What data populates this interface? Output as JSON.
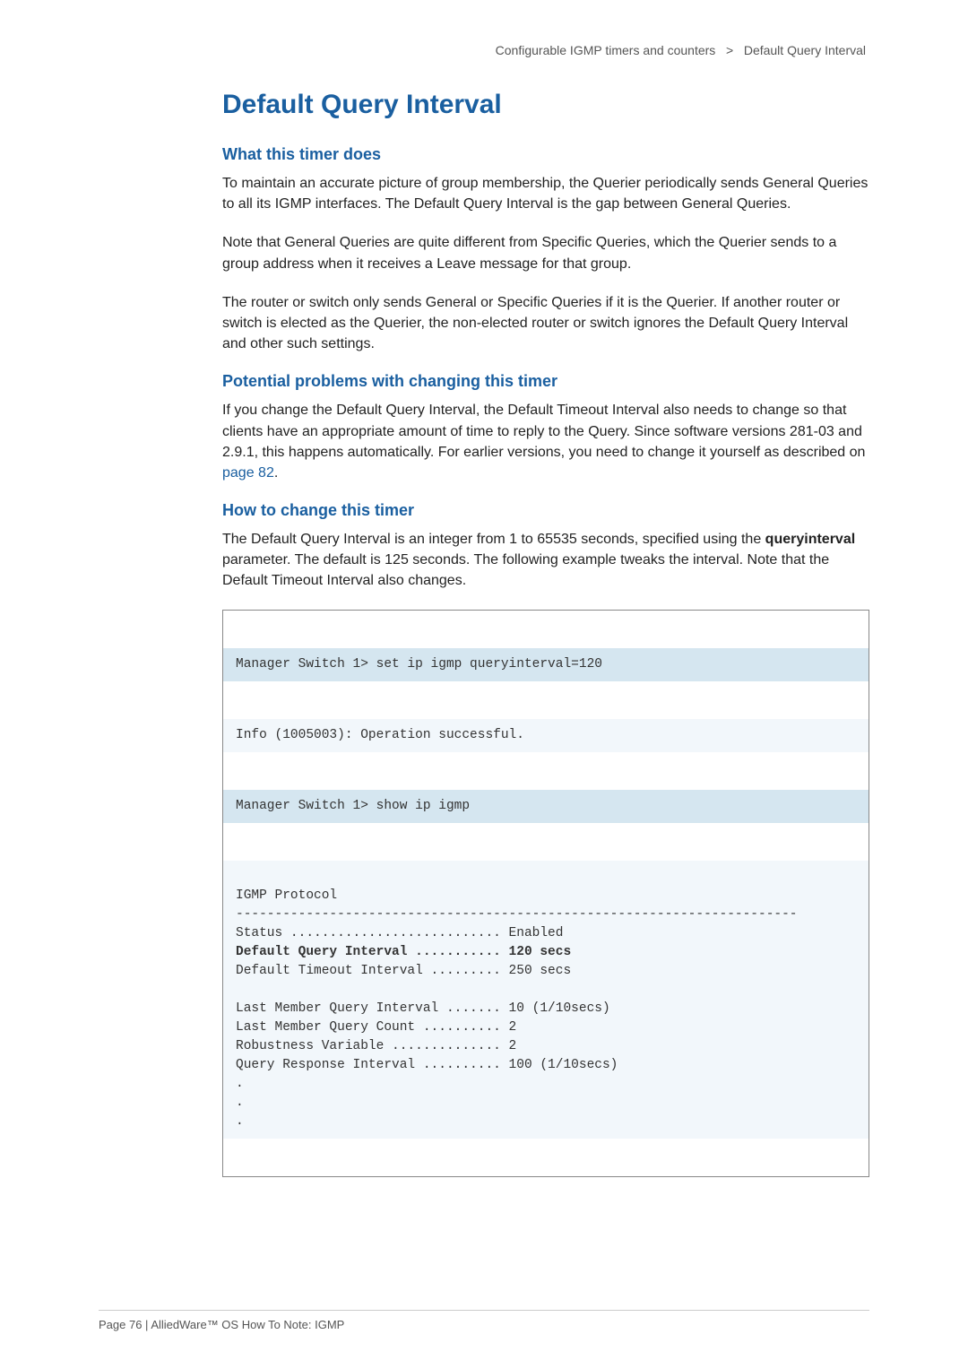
{
  "breadcrumb": {
    "left": "Configurable IGMP timers and counters",
    "sep": ">",
    "right": "Default Query Interval"
  },
  "title": "Default Query Interval",
  "sections": {
    "what": {
      "heading": "What this timer does",
      "p1": "To maintain an accurate picture of group membership, the Querier periodically sends General Queries to all its IGMP interfaces. The Default Query Interval is the gap between General Queries.",
      "p2": "Note that General Queries are quite different from Specific Queries, which the Querier sends to a group address when it receives a Leave message for that group.",
      "p3": "The router or switch only sends General or Specific Queries if it is the Querier. If another router or switch is elected as the Querier, the non-elected router or switch ignores the Default Query Interval and other such settings."
    },
    "problems": {
      "heading": "Potential problems with changing this timer",
      "p1_a": "If you change the Default Query Interval, the Default Timeout Interval also needs to change so that clients have an appropriate amount of time to reply to the Query. Since software versions 281-03 and 2.9.1, this happens automatically. For earlier versions, you need to change it yourself as described on ",
      "p1_link": "page 82",
      "p1_b": "."
    },
    "how": {
      "heading": "How to change this timer",
      "p1_a": "The Default Query Interval is an integer from 1 to 65535 seconds, specified using the ",
      "p1_bold": "queryinterval",
      "p1_b": " parameter. The default is 125 seconds. The following example tweaks the interval. Note that the Default Timeout Interval also changes."
    }
  },
  "terminal": {
    "cmd1": "Manager Switch 1> set ip igmp queryinterval=120",
    "out1": "Info (1005003): Operation successful.",
    "cmd2": "Manager Switch 1> show ip igmp",
    "out2_header": "IGMP Protocol",
    "out2_rule": "------------------------------------------------------------------------",
    "out2_status": "Status ........................... Enabled",
    "out2_dqi": "Default Query Interval ........... 120 secs",
    "out2_dti": "Default Timeout Interval ......... 250 secs",
    "out2_blank": "",
    "out2_lmqi": "Last Member Query Interval ....... 10 (1/10secs)",
    "out2_lmqc": "Last Member Query Count .......... 2",
    "out2_rv": "Robustness Variable .............. 2",
    "out2_qri": "Query Response Interval .......... 100 (1/10secs)",
    "out2_dots": ".\n.\n."
  },
  "footer": "Page 76 | AlliedWare™ OS How To Note: IGMP",
  "chart_data": {
    "type": "table",
    "title": "IGMP Protocol settings (show ip igmp)",
    "rows": [
      {
        "field": "Status",
        "value": "Enabled"
      },
      {
        "field": "Default Query Interval",
        "value": "120 secs"
      },
      {
        "field": "Default Timeout Interval",
        "value": "250 secs"
      },
      {
        "field": "Last Member Query Interval",
        "value": "10 (1/10secs)"
      },
      {
        "field": "Last Member Query Count",
        "value": "2"
      },
      {
        "field": "Robustness Variable",
        "value": "2"
      },
      {
        "field": "Query Response Interval",
        "value": "100 (1/10secs)"
      }
    ]
  }
}
